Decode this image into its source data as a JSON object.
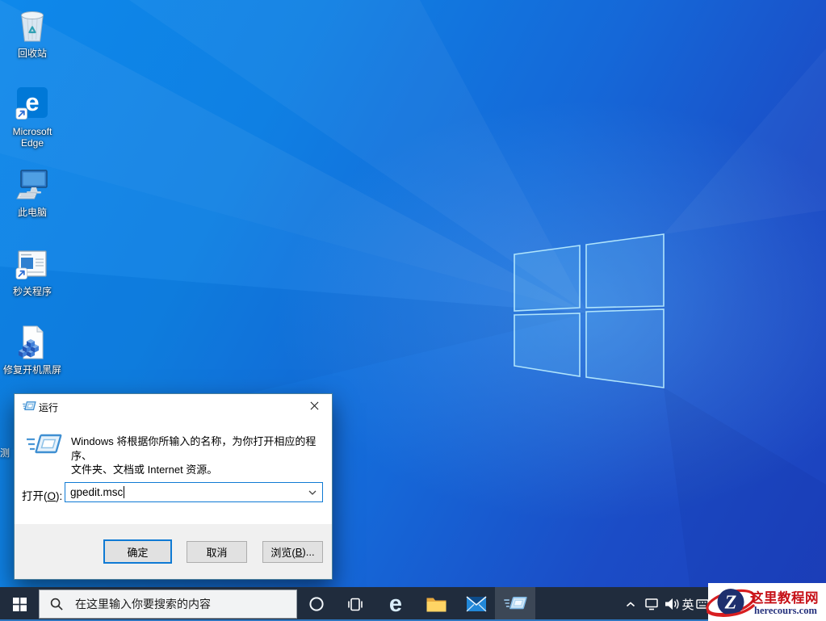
{
  "desktop": {
    "icons": [
      {
        "name": "recycle-bin",
        "label": "回收站"
      },
      {
        "name": "microsoft-edge",
        "label": "Microsoft Edge"
      },
      {
        "name": "this-pc",
        "label": "此电脑"
      },
      {
        "name": "quick-close-program",
        "label": "秒关程序"
      },
      {
        "name": "fix-boot-black-screen",
        "label": "修复开机黑屏"
      }
    ],
    "partial_icon_label": "测"
  },
  "run_dialog": {
    "title": "运行",
    "description_lines": [
      "Windows 将根据你所输入的名称，为你打开相应的程序、",
      "文件夹、文档或 Internet 资源。"
    ],
    "open_label_prefix": "打开(",
    "open_label_key": "O",
    "open_label_suffix": "):",
    "input_value": "gpedit.msc",
    "ok_label": "确定",
    "cancel_label": "取消",
    "browse_label_prefix": "浏览(",
    "browse_label_key": "B",
    "browse_label_suffix": ")..."
  },
  "taskbar": {
    "search": {
      "placeholder": "在这里输入你要搜索的内容"
    },
    "apps": [
      {
        "name": "edge"
      },
      {
        "name": "file-explorer"
      },
      {
        "name": "mail"
      },
      {
        "name": "run",
        "active": true
      }
    ],
    "tray": {
      "ime_label": "英",
      "icons": [
        "chevron-up",
        "network",
        "volume",
        "ime",
        "touch-keyboard"
      ]
    }
  },
  "watermark": {
    "site_name": "这里教程网",
    "site_url": "herecours.com",
    "logo_letter": "Z"
  },
  "colors": {
    "accent": "#0078d7",
    "taskbar_bg": "#202c3d",
    "wallpaper_top_left": "#0e88ea",
    "wallpaper_bottom_right": "#1d40bd",
    "watermark_red": "#c61017",
    "watermark_navy": "#25317c"
  }
}
